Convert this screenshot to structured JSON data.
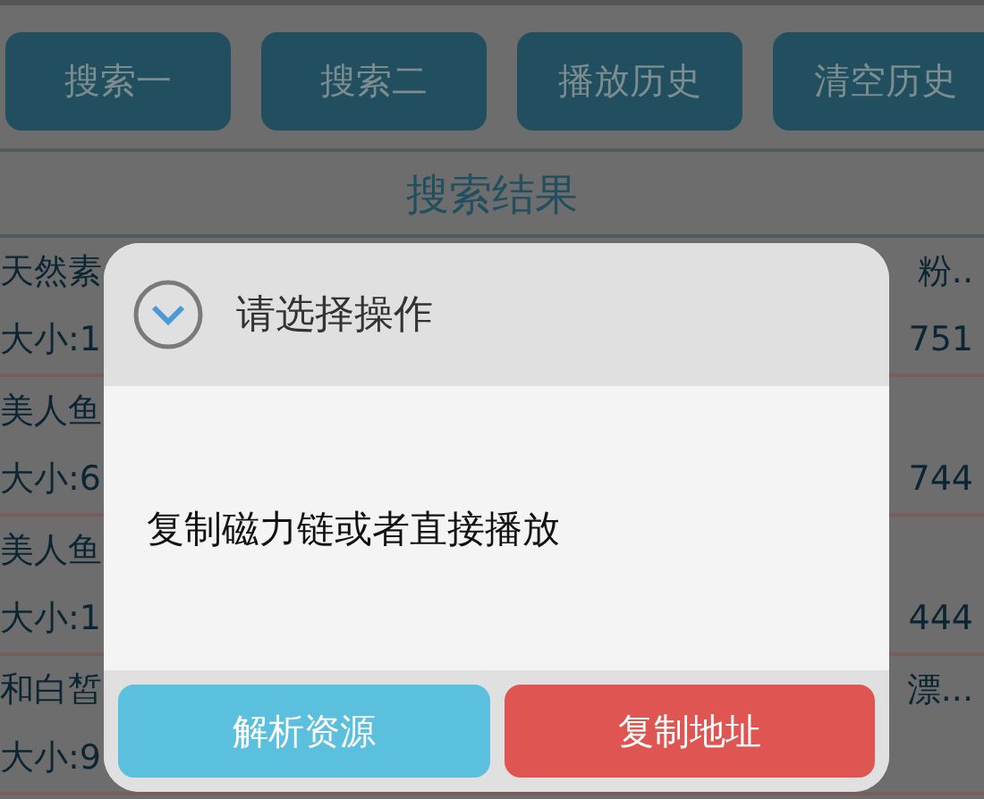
{
  "top_buttons": [
    {
      "label": "搜索一"
    },
    {
      "label": "搜索二"
    },
    {
      "label": "播放历史"
    },
    {
      "label": "清空历史"
    }
  ],
  "results_title": "搜索结果",
  "results": [
    {
      "title_start": "天然素",
      "title_end": "粉..",
      "meta_start": "大小:1",
      "meta_end": "751"
    },
    {
      "title_start": "美人鱼",
      "meta_start": "大小:6",
      "meta_end": "744"
    },
    {
      "title_start": "美人鱼",
      "meta_start": "大小:1",
      "meta_end": "444"
    },
    {
      "title_start": "和白皙",
      "title_end": "漂...",
      "meta_start": "大小:9"
    }
  ],
  "dialog": {
    "title": "请选择操作",
    "message": "复制磁力链或者直接播放",
    "buttons": [
      {
        "label": "解析资源",
        "kind": "primary"
      },
      {
        "label": "复制地址",
        "kind": "danger"
      }
    ]
  }
}
